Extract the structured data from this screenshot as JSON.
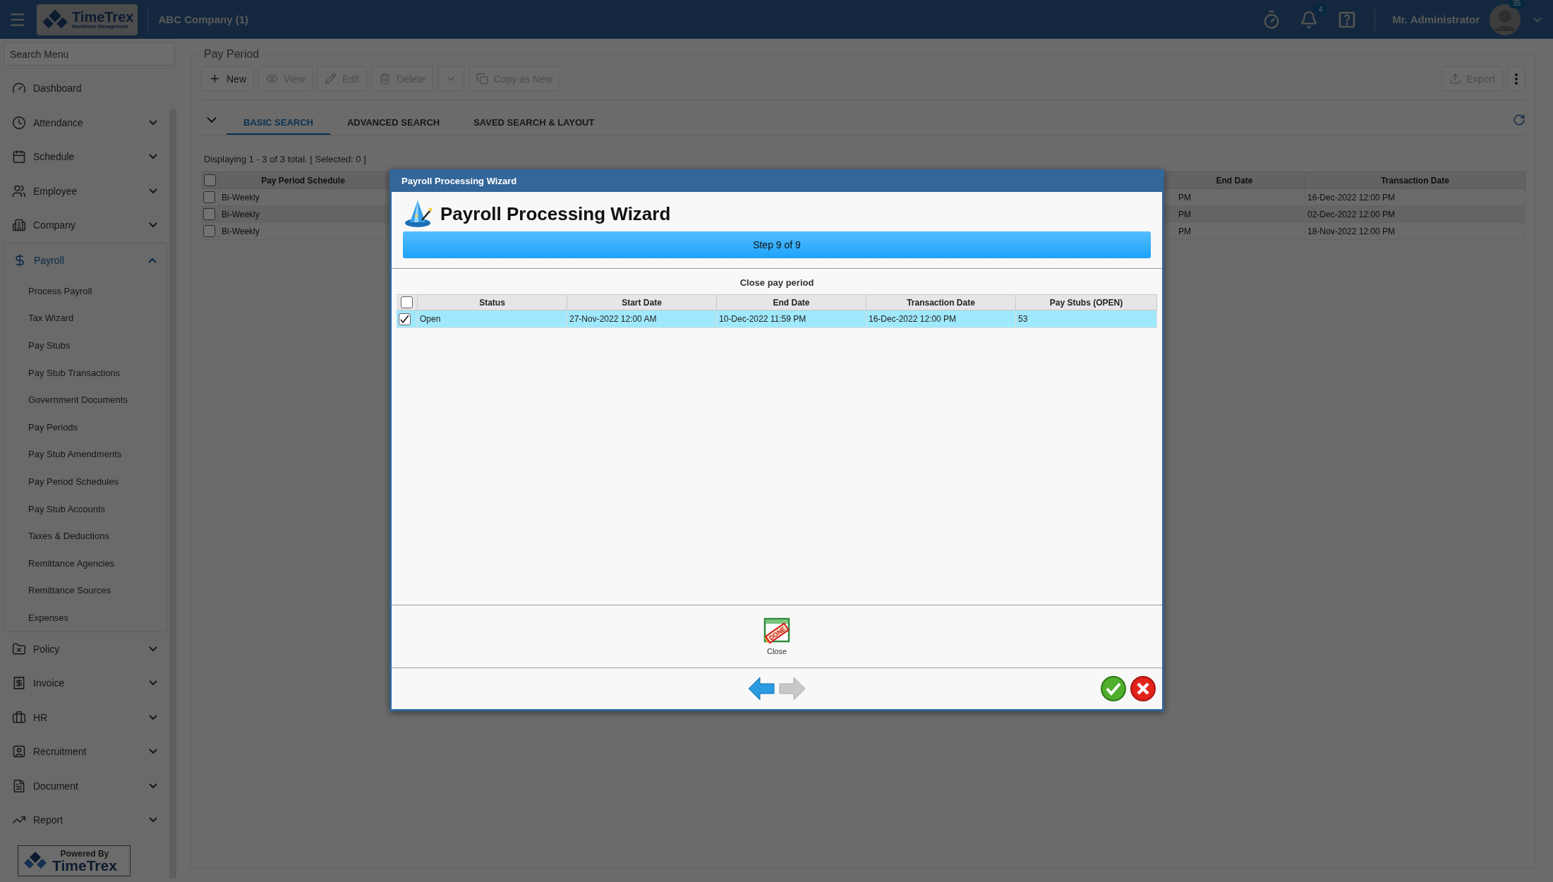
{
  "topbar": {
    "logo": {
      "name": "TimeTrex",
      "tagline": "Workforce Management"
    },
    "company": "ABC Company (1)",
    "notifications_badge": "4",
    "user": "Mr. Administrator",
    "avatar_badge": "35"
  },
  "sidebar": {
    "search": {
      "placeholder": "Search Menu"
    },
    "items": [
      {
        "label": "Dashboard",
        "kind": "link",
        "selected": false
      },
      {
        "label": "Attendance",
        "kind": "group",
        "expanded": false,
        "selected": false
      },
      {
        "label": "Schedule",
        "kind": "group",
        "expanded": false,
        "selected": false
      },
      {
        "label": "Employee",
        "kind": "group",
        "expanded": false,
        "selected": false
      },
      {
        "label": "Company",
        "kind": "group",
        "expanded": false,
        "selected": false
      },
      {
        "label": "Payroll",
        "kind": "group",
        "expanded": true,
        "selected": true,
        "children": [
          "Process Payroll",
          "Tax Wizard",
          "Pay Stubs",
          "Pay Stub Transactions",
          "Government Documents",
          "Pay Periods",
          "Pay Stub Amendments",
          "Pay Period Schedules",
          "Pay Stub Accounts",
          "Taxes & Deductions",
          "Remittance Agencies",
          "Remittance Sources",
          "Expenses"
        ]
      },
      {
        "label": "Policy",
        "kind": "group",
        "expanded": false,
        "selected": false
      },
      {
        "label": "Invoice",
        "kind": "group",
        "expanded": false,
        "selected": false
      },
      {
        "label": "HR",
        "kind": "group",
        "expanded": false,
        "selected": false
      },
      {
        "label": "Recruitment",
        "kind": "group",
        "expanded": false,
        "selected": false
      },
      {
        "label": "Document",
        "kind": "group",
        "expanded": false,
        "selected": false
      },
      {
        "label": "Report",
        "kind": "group",
        "expanded": false,
        "selected": false
      }
    ],
    "powered_by": {
      "line_1": "Powered By",
      "line_2": "TimeTrex"
    }
  },
  "main": {
    "legend": "Pay Period",
    "toolbar": [
      {
        "label": "New",
        "disabled": false
      },
      {
        "label": "View",
        "disabled": true
      },
      {
        "label": "Edit",
        "disabled": true
      },
      {
        "label": "Delete",
        "disabled": true
      },
      {
        "label": "Copy as New",
        "disabled": true
      }
    ],
    "export": {
      "label": "Export",
      "disabled": true
    },
    "tabs": [
      {
        "label": "BASIC SEARCH",
        "selected": true
      },
      {
        "label": "ADVANCED SEARCH",
        "selected": false
      },
      {
        "label": "SAVED SEARCH & LAYOUT",
        "selected": false
      }
    ],
    "status": "Displaying 1 - 3 of 3 total. [ Selected: 0 ]",
    "grid": {
      "header_checked": false,
      "columns": [
        "Pay Period Schedule",
        "End Date",
        "Transaction Date"
      ],
      "rows": [
        {
          "checked": false,
          "cells": [
            "Bi-Weekly",
            "PM",
            "16-Dec-2022 12:00 PM"
          ]
        },
        {
          "checked": false,
          "cells": [
            "Bi-Weekly",
            "PM",
            "02-Dec-2022 12:00 PM"
          ]
        },
        {
          "checked": false,
          "cells": [
            "Bi-Weekly",
            "PM",
            "18-Nov-2022 12:00 PM"
          ]
        }
      ]
    }
  },
  "dialog": {
    "title": "Payroll Processing Wizard",
    "heading": "Payroll Processing Wizard",
    "step": {
      "label": "Step 9 of 9",
      "level": 1
    },
    "section": "Close pay period",
    "grid": {
      "header_checked": false,
      "columns": [
        "Status",
        "Start Date",
        "End Date",
        "Transaction Date",
        "Pay Stubs (OPEN)"
      ],
      "rows": [
        {
          "checked": true,
          "selected": true,
          "cells": [
            "Open",
            "27-Nov-2022 12:00 AM",
            "10-Dec-2022 11:59 PM",
            "16-Dec-2022 12:00 PM",
            "53"
          ]
        }
      ]
    },
    "action": {
      "label": "Close",
      "stamp": "DONE"
    },
    "nav": {
      "back_disabled": false,
      "forward_disabled": true
    }
  }
}
